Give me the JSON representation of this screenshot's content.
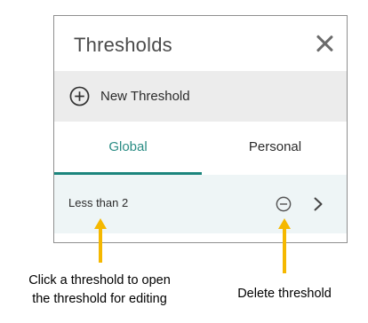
{
  "panel": {
    "title": "Thresholds",
    "close_icon": "close-icon"
  },
  "new_threshold": {
    "icon": "plus-circle-icon",
    "label": "New Threshold"
  },
  "tabs": [
    {
      "label": "Global",
      "active": true
    },
    {
      "label": "Personal",
      "active": false
    }
  ],
  "thresholds": [
    {
      "label": "Less than 2",
      "delete_icon": "minus-circle-icon",
      "open_icon": "chevron-right-icon"
    }
  ],
  "annotations": {
    "left": [
      "Click a threshold to open",
      "the threshold for editing"
    ],
    "right": "Delete threshold",
    "arrow_color": "#f5b800"
  },
  "colors": {
    "accent": "#1b857d",
    "active_tab_text": "#2a8c84",
    "row_background": "#eef5f6",
    "new_row_background": "#ececec"
  }
}
